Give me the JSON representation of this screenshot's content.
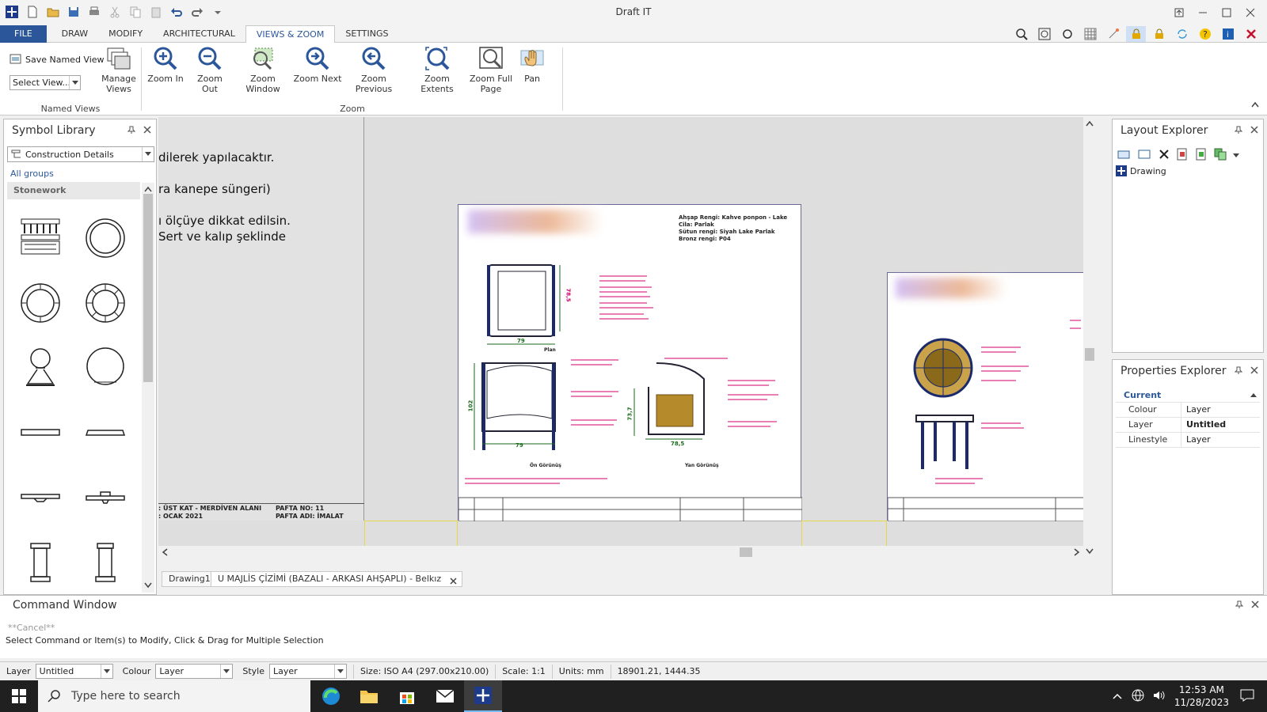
{
  "app": {
    "title": "Draft IT"
  },
  "menu": {
    "file": "FILE",
    "draw": "DRAW",
    "modify": "MODIFY",
    "architectural": "ARCHITECTURAL",
    "views_zoom": "VIEWS & ZOOM",
    "settings": "SETTINGS"
  },
  "ribbon": {
    "named_views": {
      "save_label": "Save Named View",
      "select_placeholder": "Select View...",
      "manage_label": "Manage Views",
      "group_label": "Named Views"
    },
    "zoom": {
      "group_label": "Zoom",
      "buttons": [
        "Zoom In",
        "Zoom Out",
        "Zoom Window",
        "Zoom Next",
        "Zoom Previous",
        "Zoom Extents",
        "Zoom Full Page",
        "Pan"
      ]
    }
  },
  "symbol_library": {
    "title": "Symbol Library",
    "category": "Construction Details",
    "all_groups": "All groups",
    "group": "Stonework"
  },
  "layout_explorer": {
    "title": "Layout Explorer",
    "tree_item": "Drawing"
  },
  "properties_explorer": {
    "title": "Properties Explorer",
    "section": "Current",
    "rows": [
      {
        "key": "Colour",
        "value": "Layer"
      },
      {
        "key": "Layer",
        "value": "Untitled"
      },
      {
        "key": "Linestyle",
        "value": "Layer"
      }
    ]
  },
  "drawing": {
    "text_lines": [
      "dilerek yapılacaktır.",
      "ra kanepe süngeri)",
      "ı ölçüye dikkat edilsin.",
      "Sert ve kalıp şeklinde"
    ],
    "title_block_left": [
      ": ÜST KAT - MERDİVEN ALANI",
      "PAFTA NO: 11",
      ": OCAK 2021",
      "PAFTA ADI: İMALAT"
    ],
    "sheet_notes": [
      "Ahşap Rengi: Kahve ponpon - Lake",
      "Cila: Parlak",
      "Sütun rengi: Siyah Lake Parlak",
      "Bronz rengi: P04"
    ],
    "dims": [
      "78,5",
      "79",
      "102",
      "79",
      "73,7",
      "78,5"
    ],
    "labels": [
      "Plan",
      "Ön Görünüş",
      "Yan Görünüş"
    ]
  },
  "tabs": [
    "Drawing1",
    "U MAJLİS ÇİZİMİ (BAZALI - ARKASI AHŞAPLI) - Belkız"
  ],
  "command_window": {
    "title": "Command Window",
    "history": "**Cancel**",
    "prompt": "Select Command or Item(s) to Modify, Click & Drag for Multiple Selection"
  },
  "status": {
    "layer_label": "Layer",
    "layer_value": "Untitled",
    "colour_label": "Colour",
    "colour_value": "Layer",
    "style_label": "Style",
    "style_value": "Layer",
    "size": "Size: ISO A4 (297.00x210.00)",
    "scale": "Scale: 1:1",
    "units": "Units: mm",
    "coords": "18901.21, 1444.35"
  },
  "taskbar": {
    "search_placeholder": "Type here to search",
    "time": "12:53 AM",
    "date": "11/28/2023"
  },
  "colors": {
    "accent": "#2b579a",
    "taskbar": "#202020",
    "magenta": "#d4006a"
  }
}
